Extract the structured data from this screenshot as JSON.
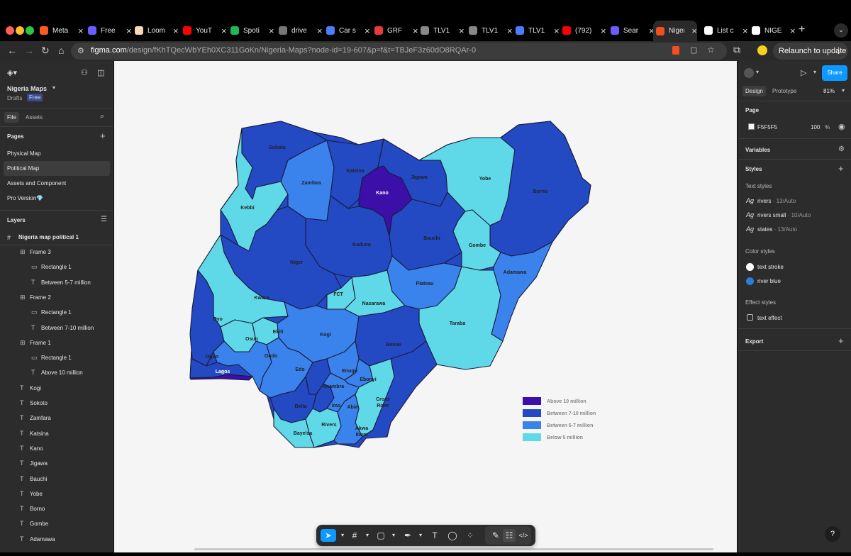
{
  "browser": {
    "tabs": [
      {
        "title": "Meta",
        "color": "#ff5a1f"
      },
      {
        "title": "Free",
        "color": "#6a5cff"
      },
      {
        "title": "Loom",
        "color": "#f7d8b8"
      },
      {
        "title": "YouT",
        "color": "#ff0000"
      },
      {
        "title": "Spoti",
        "color": "#1db954"
      },
      {
        "title": "drive",
        "color": "#777777"
      },
      {
        "title": "Car s",
        "color": "#4a7dff"
      },
      {
        "title": "GRF",
        "color": "#e93b3b"
      },
      {
        "title": "TLV1",
        "color": "#888888"
      },
      {
        "title": "TLV1",
        "color": "#888888"
      },
      {
        "title": "TLV1",
        "color": "#4a7dff"
      },
      {
        "title": "(792)",
        "color": "#ff0000"
      },
      {
        "title": "Sear",
        "color": "#6a5cff"
      },
      {
        "title": "Niger",
        "color": "#f24e1e"
      },
      {
        "title": "List c",
        "color": "#ffffff"
      },
      {
        "title": "NIGE",
        "color": "#ffffff"
      }
    ],
    "new_tab": "+",
    "url_host": "figma.com",
    "url_rest": "/design/fKhTQecWbYEh0XC311GoKn/Nigeria-Maps?node-id=19-607&p=f&t=TBJeF3z60dO8RQAr-0",
    "relaunch": "Relaunch to update"
  },
  "left": {
    "file_name": "Nigeria Maps",
    "drafts": "Drafts",
    "plan": "Free",
    "tab_file": "File",
    "tab_assets": "Assets",
    "pages_title": "Pages",
    "pages": [
      "Physical Map",
      "Political Map",
      "Assets and Component",
      "Pro Version💎"
    ],
    "layers_title": "Layers",
    "root_layer": "Nigeria map political 1",
    "layers": [
      {
        "name": "Frame 3",
        "icon": "frame"
      },
      {
        "name": "Rectangle 1",
        "icon": "rect"
      },
      {
        "name": "Between 5-7 million",
        "icon": "text"
      },
      {
        "name": "Frame 2",
        "icon": "frame"
      },
      {
        "name": "Rectangle 1",
        "icon": "rect"
      },
      {
        "name": "Between 7-10 million",
        "icon": "text"
      },
      {
        "name": "Frame 1",
        "icon": "frame"
      },
      {
        "name": "Rectangle 1",
        "icon": "rect"
      },
      {
        "name": "Above 10 million",
        "icon": "text"
      },
      {
        "name": "Kogi",
        "icon": "text"
      },
      {
        "name": "Sokoto",
        "icon": "text"
      },
      {
        "name": "Zamfara",
        "icon": "text"
      },
      {
        "name": "Katsina",
        "icon": "text"
      },
      {
        "name": "Kano",
        "icon": "text"
      },
      {
        "name": "Jigawa",
        "icon": "text"
      },
      {
        "name": "Bauchi",
        "icon": "text"
      },
      {
        "name": "Yobe",
        "icon": "text"
      },
      {
        "name": "Borno",
        "icon": "text"
      },
      {
        "name": "Gombe",
        "icon": "text"
      },
      {
        "name": "Adamawa",
        "icon": "text"
      }
    ]
  },
  "right": {
    "tab_design": "Design",
    "tab_prototype": "Prototype",
    "zoom": "81%",
    "share": "Share",
    "page_title": "Page",
    "page_color": "F5F5F5",
    "page_opacity": "100",
    "percent": "%",
    "variables": "Variables",
    "styles": "Styles",
    "text_styles": "Text styles",
    "text_style_items": [
      {
        "name": "rivers",
        "meta": " · 13/Auto"
      },
      {
        "name": "rivers small",
        "meta": " · 10/Auto"
      },
      {
        "name": "states",
        "meta": " · 13/Auto"
      }
    ],
    "color_styles": "Color styles",
    "color_style_items": [
      {
        "name": "text stroke",
        "color": "#ffffff"
      },
      {
        "name": "river blue",
        "color": "#2f7bd6"
      }
    ],
    "effect_styles": "Effect styles",
    "effect_item": "text effect",
    "export": "Export",
    "ag": "Ag"
  },
  "map": {
    "colors": {
      "above10": "#3b0fa8",
      "b7_10": "#2349c3",
      "b5_7": "#3a82ec",
      "below5": "#5fd9e8"
    },
    "legend": [
      {
        "label": "Above 10 million",
        "key": "above10"
      },
      {
        "label": "Between 7-10 million",
        "key": "b7_10"
      },
      {
        "label": "Between 5-7 million",
        "key": "b5_7"
      },
      {
        "label": "Below 5 million",
        "key": "below5"
      }
    ],
    "states": {
      "sokoto": "Sokoto",
      "katsina": "Katsina",
      "jigawa": "Jigawa",
      "yobe": "Yobe",
      "borno": "Borno",
      "zamfara": "Zamfara",
      "kano": "Kano",
      "kebbi": "Kebbi",
      "bauchi": "Bauchi",
      "gombe": "Gombe",
      "kaduna": "Kaduna",
      "niger": "Niger",
      "adamawa": "Adamawa",
      "plateau": "Plateau",
      "fct": "FCT",
      "nasarawa": "Nasarawa",
      "kwara": "Kwara",
      "oyo": "Oyo",
      "taraba": "Taraba",
      "ekiti": "Ekiti",
      "osun": "Osun",
      "kogi": "Kogi",
      "benue": "Benue",
      "ondo": "Ondo",
      "ogun": "Ogun",
      "edo": "Edo",
      "lagos": "Lagos",
      "enugu": "Enugu",
      "ebonyi": "Ebonyi",
      "anambra": "Anambra",
      "cross_river": "Cross River",
      "delta": "Delta",
      "imo": "Imo",
      "abia": "Abia",
      "rivers": "Rivers",
      "akwa_ibom": "Akwa Ibom",
      "bayelsa": "Bayelsa"
    }
  }
}
